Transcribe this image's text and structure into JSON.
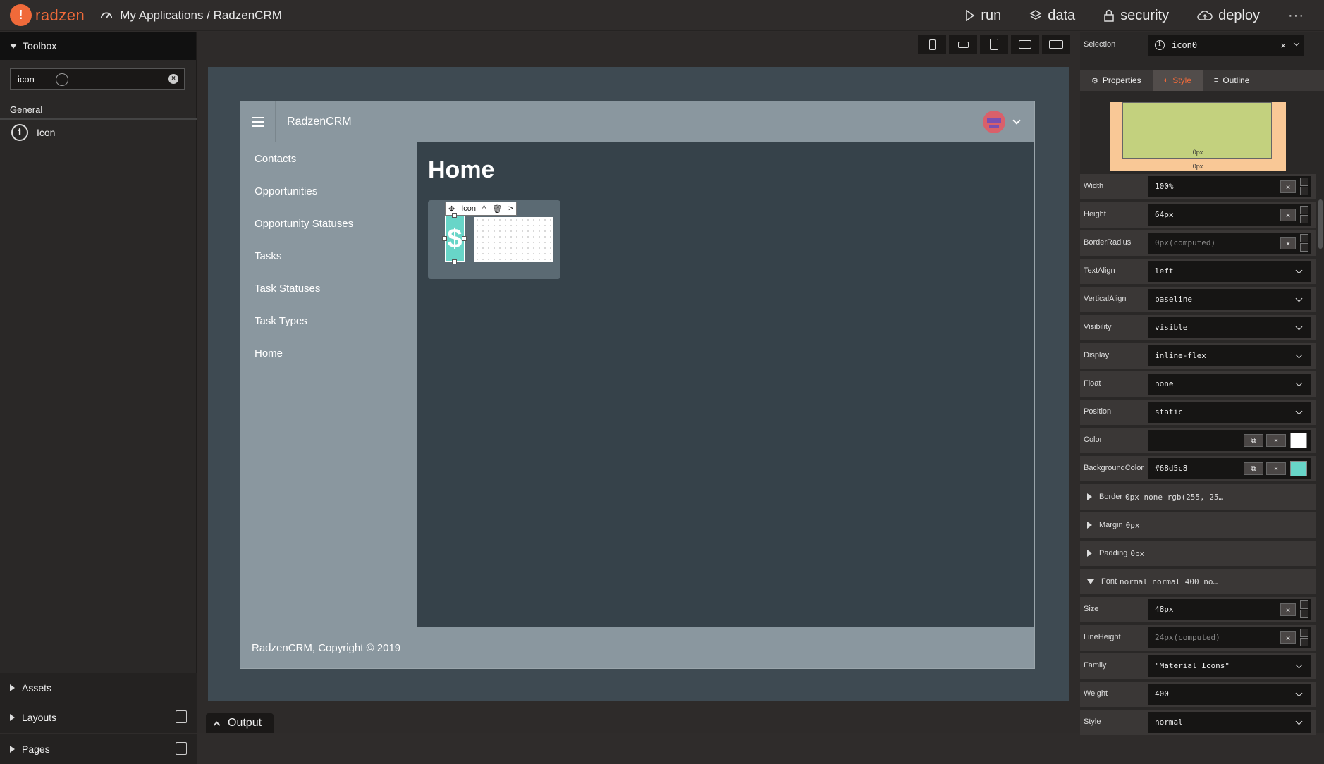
{
  "app": {
    "logo_text": "radzen",
    "breadcrumb": "My Applications / RadzenCRM"
  },
  "topnav": {
    "run": "run",
    "data": "data",
    "security": "security",
    "deploy": "deploy",
    "more": "···"
  },
  "left": {
    "toolbox_title": "Toolbox",
    "search_value": "icon",
    "general_label": "General",
    "items": [
      {
        "label": "Icon",
        "icon": "info-icon"
      }
    ],
    "assets": "Assets",
    "layouts": "Layouts",
    "pages": "Pages"
  },
  "output_label": "Output",
  "canvas": {
    "app_title": "RadzenCRM",
    "sidebar_links": [
      "Contacts",
      "Opportunities",
      "Opportunity Statuses",
      "Tasks",
      "Task Statuses",
      "Task Types",
      "Home"
    ],
    "page_title": "Home",
    "icon_glyph": "$",
    "selection_toolbar_label": "Icon",
    "footer": "RadzenCRM, Copyright © 2019"
  },
  "right": {
    "selection_label": "Selection",
    "selection_value": "icon0",
    "tabs": [
      "Properties",
      "Style",
      "Outline"
    ],
    "box_inner": "0px",
    "box_outer": "0px",
    "props": {
      "width": {
        "label": "Width",
        "value": "100%"
      },
      "height": {
        "label": "Height",
        "value": "64px"
      },
      "borderRadius": {
        "label": "BorderRadius",
        "value": "0px(computed)"
      },
      "textAlign": {
        "label": "TextAlign",
        "value": "left"
      },
      "verticalAlign": {
        "label": "VerticalAlign",
        "value": "baseline"
      },
      "visibility": {
        "label": "Visibility",
        "value": "visible"
      },
      "display": {
        "label": "Display",
        "value": "inline-flex"
      },
      "float": {
        "label": "Float",
        "value": "none"
      },
      "position": {
        "label": "Position",
        "value": "static"
      },
      "color": {
        "label": "Color",
        "value": "",
        "swatch": "#ffffff"
      },
      "backgroundColor": {
        "label": "BackgroundColor",
        "value": "#68d5c8",
        "swatch": "#68d5c8"
      },
      "size": {
        "label": "Size",
        "value": "48px"
      },
      "lineHeight": {
        "label": "LineHeight",
        "value": "24px(computed)"
      },
      "family": {
        "label": "Family",
        "value": "\"Material Icons\""
      },
      "weight": {
        "label": "Weight",
        "value": "400"
      },
      "style": {
        "label": "Style",
        "value": "normal"
      }
    },
    "groups": {
      "border": {
        "label": "Border",
        "value": "0px none rgb(255, 25…"
      },
      "margin": {
        "label": "Margin",
        "value": "0px"
      },
      "padding": {
        "label": "Padding",
        "value": "0px"
      },
      "font": {
        "label": "Font",
        "value": "normal normal 400 no…"
      }
    }
  }
}
